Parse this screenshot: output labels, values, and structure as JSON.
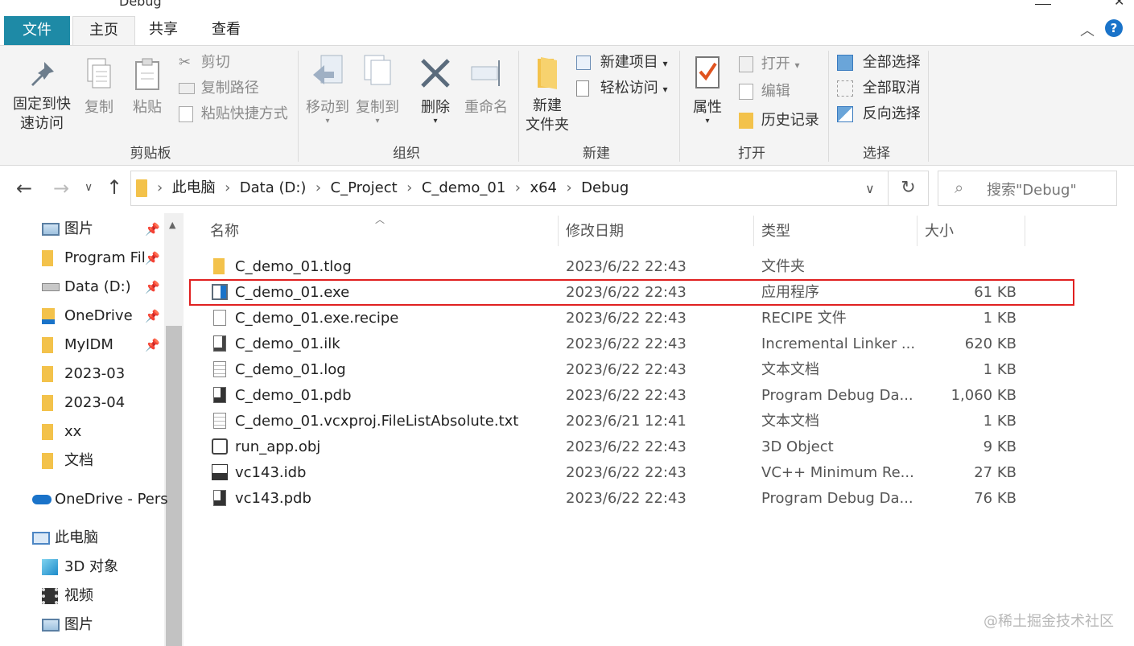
{
  "window": {
    "title": "Debug"
  },
  "tabs": [
    {
      "label": "文件"
    },
    {
      "label": "主页"
    },
    {
      "label": "共享"
    },
    {
      "label": "查看"
    }
  ],
  "ribbon": {
    "clipboard": {
      "pin_label_1": "固定到快",
      "pin_label_2": "速访问",
      "copy": "复制",
      "paste": "粘贴",
      "cut": "剪切",
      "copy_path": "复制路径",
      "paste_shortcut": "粘贴快捷方式",
      "group": "剪贴板"
    },
    "organize": {
      "move_to": "移动到",
      "copy_to": "复制到",
      "delete": "删除",
      "rename": "重命名",
      "group": "组织"
    },
    "new": {
      "new_folder_1": "新建",
      "new_folder_2": "文件夹",
      "new_item": "新建项目",
      "easy_access": "轻松访问",
      "group": "新建"
    },
    "open": {
      "properties": "属性",
      "open": "打开",
      "edit": "编辑",
      "history": "历史记录",
      "group": "打开"
    },
    "select": {
      "select_all": "全部选择",
      "select_none": "全部取消",
      "invert": "反向选择",
      "group": "选择"
    }
  },
  "address": {
    "crumbs": [
      "此电脑",
      "Data (D:)",
      "C_Project",
      "C_demo_01",
      "x64",
      "Debug"
    ],
    "search_placeholder": "搜索\"Debug\""
  },
  "nav": {
    "items": [
      {
        "label": "图片",
        "icon": "pictures-icon",
        "pinned": true
      },
      {
        "label": "Program Fil",
        "icon": "folder-icon",
        "pinned": true
      },
      {
        "label": "Data (D:)",
        "icon": "drive-icon",
        "pinned": true
      },
      {
        "label": "OneDrive",
        "icon": "onedrive-folder-icon",
        "pinned": true
      },
      {
        "label": "MyIDM",
        "icon": "folder-icon",
        "pinned": true
      },
      {
        "label": "2023-03",
        "icon": "folder-icon",
        "pinned": false
      },
      {
        "label": "2023-04",
        "icon": "folder-icon",
        "pinned": false
      },
      {
        "label": "xx",
        "icon": "folder-icon",
        "pinned": false
      },
      {
        "label": "文档",
        "icon": "folder-icon",
        "pinned": false
      },
      {
        "label": "OneDrive - Pers",
        "icon": "onedrive-cloud-icon",
        "pinned": false
      },
      {
        "label": "此电脑",
        "icon": "this-pc-icon",
        "pinned": false
      },
      {
        "label": "3D 对象",
        "icon": "3d-objects-icon",
        "pinned": false
      },
      {
        "label": "视频",
        "icon": "videos-icon",
        "pinned": false
      },
      {
        "label": "图片",
        "icon": "pictures-icon",
        "pinned": false
      }
    ]
  },
  "columns": {
    "name": "名称",
    "date": "修改日期",
    "type": "类型",
    "size": "大小"
  },
  "files": [
    {
      "name": "C_demo_01.tlog",
      "date": "2023/6/22 22:43",
      "type": "文件夹",
      "size": "",
      "icon": "folder-icon"
    },
    {
      "name": "C_demo_01.exe",
      "date": "2023/6/22 22:43",
      "type": "应用程序",
      "size": "61 KB",
      "icon": "exe-icon"
    },
    {
      "name": "C_demo_01.exe.recipe",
      "date": "2023/6/22 22:43",
      "type": "RECIPE 文件",
      "size": "1 KB",
      "icon": "file-icon"
    },
    {
      "name": "C_demo_01.ilk",
      "date": "2023/6/22 22:43",
      "type": "Incremental Linker ...",
      "size": "620 KB",
      "icon": "ilk-icon"
    },
    {
      "name": "C_demo_01.log",
      "date": "2023/6/22 22:43",
      "type": "文本文档",
      "size": "1 KB",
      "icon": "text-file-icon"
    },
    {
      "name": "C_demo_01.pdb",
      "date": "2023/6/22 22:43",
      "type": "Program Debug Da...",
      "size": "1,060 KB",
      "icon": "pdb-icon"
    },
    {
      "name": "C_demo_01.vcxproj.FileListAbsolute.txt",
      "date": "2023/6/21 12:41",
      "type": "文本文档",
      "size": "1 KB",
      "icon": "text-file-icon"
    },
    {
      "name": "run_app.obj",
      "date": "2023/6/22 22:43",
      "type": "3D Object",
      "size": "9 KB",
      "icon": "3d-object-file-icon"
    },
    {
      "name": "vc143.idb",
      "date": "2023/6/22 22:43",
      "type": "VC++ Minimum Re...",
      "size": "27 KB",
      "icon": "idb-icon"
    },
    {
      "name": "vc143.pdb",
      "date": "2023/6/22 22:43",
      "type": "Program Debug Da...",
      "size": "76 KB",
      "icon": "pdb-icon"
    }
  ],
  "watermark": "@稀土掘金技术社区",
  "colors": {
    "file_tab": "#1e8aa6",
    "highlight": "#e02020",
    "folder": "#f3c24b",
    "accent": "#1a73c9"
  }
}
